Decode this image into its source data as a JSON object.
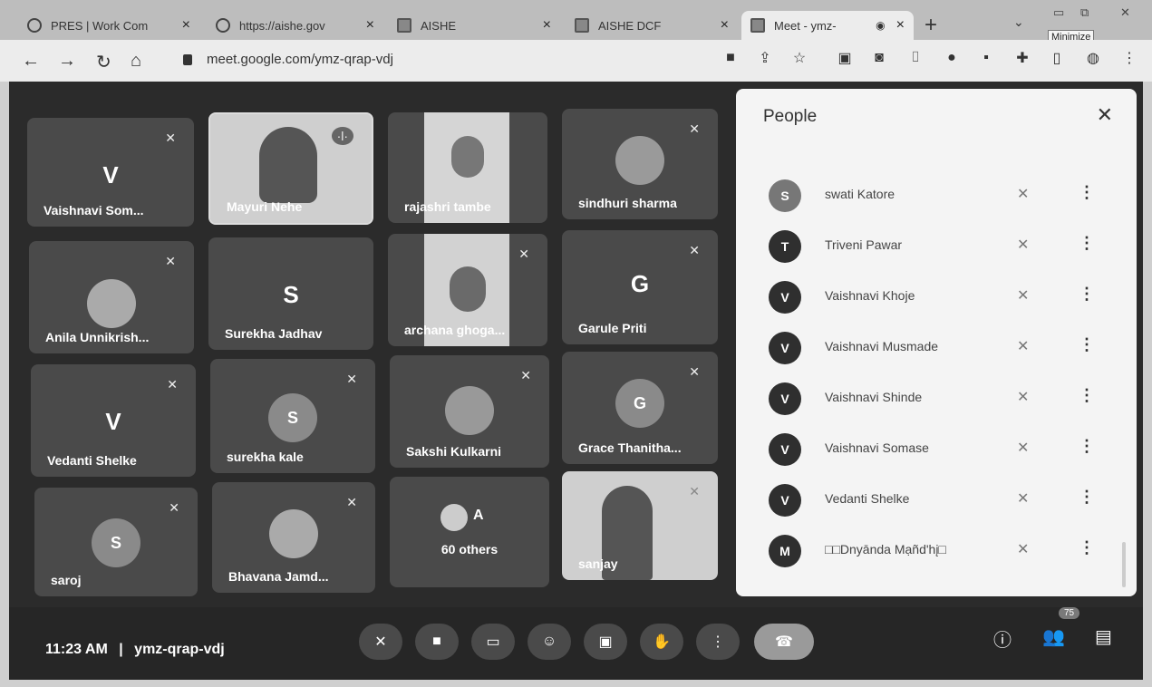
{
  "browser": {
    "tabs": [
      {
        "label": "PRES | Work Com",
        "close": "×",
        "icon": "globe-icon"
      },
      {
        "label": "https://aishe.gov",
        "close": "×",
        "icon": "globe-icon"
      },
      {
        "label": "AISHE",
        "close": "×",
        "icon": "image-icon"
      },
      {
        "label": "AISHE DCF",
        "close": "×",
        "icon": "image-icon"
      },
      {
        "label": "Meet - ymz-",
        "close": "×",
        "icon": "camera-icon"
      }
    ],
    "new_tab": "+",
    "tab_menu": "⌄",
    "minimize_tooltip": "Minimize",
    "url": "meet.google.com/ymz-qrap-vdj"
  },
  "tiles": [
    {
      "name": "Vaishnavi Som...",
      "letter": "V"
    },
    {
      "name": "Mayuri Nehe"
    },
    {
      "name": "rajashri tambe"
    },
    {
      "name": "sindhuri sharma"
    },
    {
      "name": "Anila Unnikrish..."
    },
    {
      "name": "Surekha Jadhav",
      "letter": "S"
    },
    {
      "name": "archana ghoga..."
    },
    {
      "name": "Garule Priti",
      "letter": "G"
    },
    {
      "name": "Vedanti Shelke",
      "letter": "V"
    },
    {
      "name": "surekha kale",
      "letter": "S"
    },
    {
      "name": "Sakshi Kulkarni"
    },
    {
      "name": "Grace Thanitha...",
      "letter": "G"
    },
    {
      "name": "saroj",
      "letter": "S"
    },
    {
      "name": "Bhavana Jamd..."
    },
    {
      "name": "60 others",
      "letter": "A"
    },
    {
      "name": "sanjay"
    }
  ],
  "meeting": {
    "time": "11:23 AM",
    "separator": "|",
    "code": "ymz-qrap-vdj",
    "participant_count": "75"
  },
  "people_panel": {
    "title": "People",
    "close": "✕",
    "participants": [
      {
        "name": "swati Katore",
        "initial": "S"
      },
      {
        "name": "Triveni Pawar",
        "initial": "T"
      },
      {
        "name": "Vaishnavi Khoje",
        "initial": "V"
      },
      {
        "name": "Vaishnavi Musmade",
        "initial": "V"
      },
      {
        "name": "Vaishnavi Shinde",
        "initial": "V"
      },
      {
        "name": "Vaishnavi Somase",
        "initial": "V"
      },
      {
        "name": "Vedanti Shelke",
        "initial": "V"
      },
      {
        "name": "□□Dnyānda Mạñd'hį□",
        "initial": "M"
      }
    ]
  }
}
